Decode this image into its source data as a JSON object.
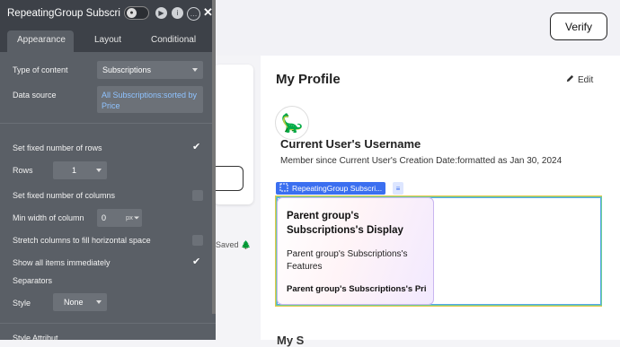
{
  "page": {
    "verify_label": "Verify",
    "profile_title": "My Profile",
    "edit_label": "Edit",
    "avatar_glyph": "🦕",
    "username": "Current User's Username",
    "member_since": "Member since Current User's Creation Date:formatted as Jan 30, 2024",
    "rg_tag_label": "RepeatingGroup Subscri...",
    "saved_text": "Saved 🌲",
    "bottom_text": "My S",
    "cell": {
      "title": "Parent group's Subscriptions's Display",
      "features": "Parent group's Subscriptions's Features",
      "price": "Parent group's Subscriptions's Pri"
    }
  },
  "panel": {
    "title": "RepeatingGroup Subscri",
    "tabs": [
      "Appearance",
      "Layout",
      "Conditional"
    ],
    "type_of_content_label": "Type of content",
    "type_of_content_value": "Subscriptions",
    "data_source_label": "Data source",
    "data_source_value": "All Subscriptions:sorted by Price",
    "fixed_rows_label": "Set fixed number of rows",
    "rows_label": "Rows",
    "rows_value": "1",
    "fixed_cols_label": "Set fixed number of columns",
    "min_width_label": "Min width of column",
    "min_width_value": "0",
    "min_width_unit": "px",
    "stretch_label": "Stretch columns to fill horizontal space",
    "show_all_label": "Show all items immediately",
    "separators_label": "Separators",
    "style_label": "Style",
    "style_value": "None",
    "bottom_label": "Style Attribut"
  },
  "colors": {
    "accent": "#3b6ff0",
    "panel_bg": "#5a5f66",
    "panel_header": "#3d4148"
  }
}
